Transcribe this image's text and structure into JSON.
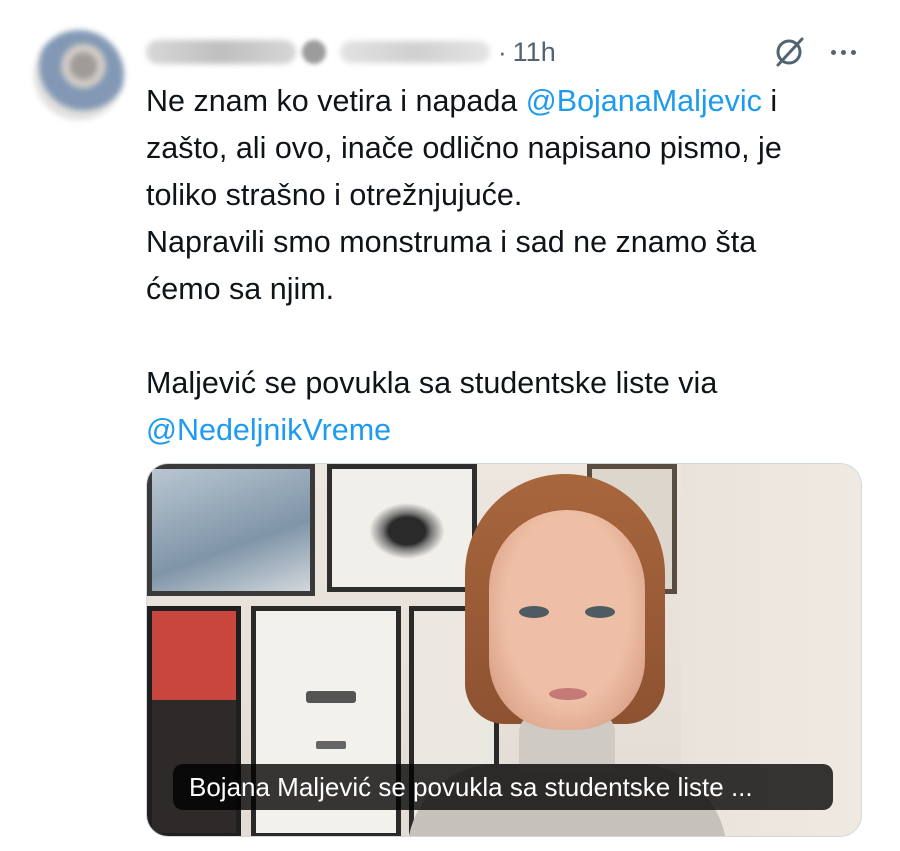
{
  "header": {
    "separator": "·",
    "time": "11h",
    "grok_icon": "grok-icon",
    "more_icon": "more-icon"
  },
  "tweet": {
    "lines": [
      {
        "pre": "Ne znam ko vetira i napada ",
        "mention": "@BojanaMaljevic",
        "post": " i"
      },
      {
        "pre": "zašto, ali ovo,  inače odlično napisano pismo, je"
      },
      {
        "pre": "toliko strašno i otrežnjujuće."
      },
      {
        "pre": "Napravili smo monstruma i sad ne znamo šta"
      },
      {
        "pre": "ćemo sa njim."
      },
      {
        "pre": "Maljević se povukla sa studentske liste via"
      },
      {
        "mention": "@NedeljnikVreme"
      }
    ]
  },
  "media": {
    "caption": "Bojana Maljević se povukla sa studentske liste ..."
  },
  "colors": {
    "text": "#0f1419",
    "secondary": "#536471",
    "link": "#1d9bf0"
  }
}
